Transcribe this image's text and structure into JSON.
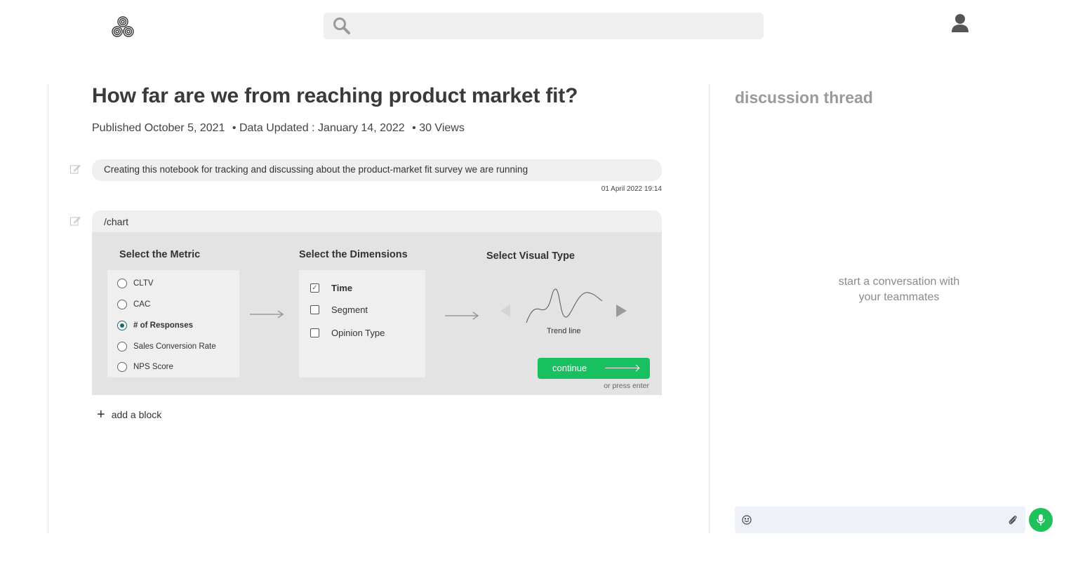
{
  "header": {
    "logo_icon": "triple-spiral-logo-icon",
    "search_icon": "search-icon",
    "search_placeholder": "",
    "user_icon": "user-icon"
  },
  "notebook": {
    "title": "How far are we from reaching product market fit?",
    "published": "Published October 5, 2021",
    "data_updated": "• Data Updated : January 14, 2022",
    "views": "• 30 Views",
    "blocks": [
      {
        "type": "text",
        "text": "Creating this notebook for tracking and discussing about the product-market fit survey we are running",
        "timestamp": "01 April 2022  19:14"
      },
      {
        "type": "command",
        "text": "/chart"
      }
    ],
    "add_block_label": "add a block"
  },
  "chart_builder": {
    "metric": {
      "title": "Select the Metric",
      "options": [
        "CLTV",
        "CAC",
        "# of Responses",
        "Sales Conversion Rate",
        "NPS Score"
      ],
      "selected": "# of Responses"
    },
    "dimensions": {
      "title": "Select the Dimensions",
      "options": [
        "Time",
        "Segment",
        "Opinion Type"
      ],
      "checked": [
        "Time"
      ]
    },
    "visual": {
      "title": "Select Visual Type",
      "current": "Trend line",
      "prev_icon": "caret-left-icon",
      "next_icon": "caret-right-icon"
    },
    "continue_label": "continue",
    "hint": "or press enter"
  },
  "discussion": {
    "title": "discussion thread",
    "empty_line1": "start a conversation with",
    "empty_line2": "your teammates",
    "input_placeholder": "",
    "emoji_icon": "smiley-icon",
    "attach_icon": "paperclip-icon",
    "mic_icon": "microphone-icon"
  },
  "colors": {
    "accent_green": "#18c060",
    "radio_teal": "#1b6b6b",
    "panel_gray": "#e3e3e3",
    "block_gray": "#efefef"
  }
}
